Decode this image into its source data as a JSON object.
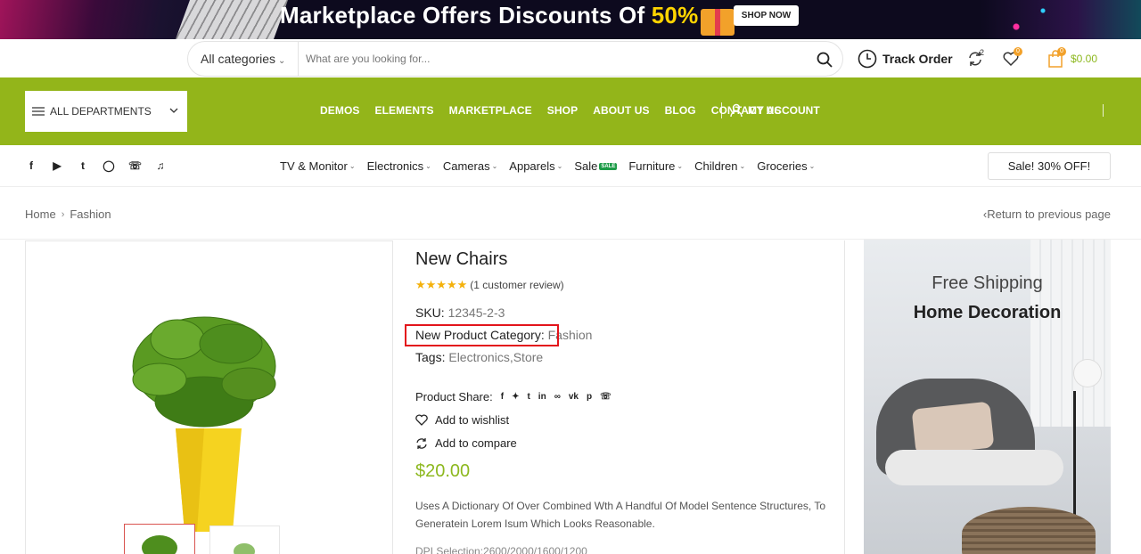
{
  "promo": {
    "headline": "Marketplace Offers Discounts Of ",
    "highlight": "50%",
    "cta": "SHOP NOW"
  },
  "search": {
    "category": "All categories",
    "placeholder": "What are you looking for...",
    "track_label": "Track Order",
    "compare_count": "2",
    "wishlist_count": "0",
    "cart_count": "0",
    "cart_total": "$0.00"
  },
  "nav": {
    "all_departments": "ALL DEPARTMENTS",
    "items": [
      "DEMOS",
      "ELEMENTS",
      "MARKETPLACE",
      "SHOP",
      "ABOUT US",
      "BLOG",
      "CONTACT US"
    ],
    "my_account": "MY ACCOUNT"
  },
  "categories": {
    "items": [
      "TV & Monitor",
      "Electronics",
      "Cameras",
      "Apparels",
      "Sale",
      "Furniture",
      "Children",
      "Groceries"
    ],
    "sale_badge": "SALE",
    "sale_button": "Sale! 30% OFF!"
  },
  "breadcrumb": {
    "home": "Home",
    "current": "Fashion",
    "return": "Return to previous page"
  },
  "product": {
    "title": "New Chairs",
    "rating": 5,
    "review_text": "(1 customer review)",
    "sku_label": "SKU:",
    "sku_value": "12345-2-3",
    "category_label": "New Product Category:",
    "category_value": "Fashion",
    "tags_label": "Tags:",
    "tag_1": "Electronics",
    "tag_sep": ",",
    "tag_2": "Store",
    "share_label": "Product Share:",
    "wishlist_label": "Add to wishlist",
    "compare_label": "Add to compare",
    "price": "$20.00",
    "description": "Uses A Dictionary Of Over Combined Wth A Handful Of Model Sentence Structures, To Generatein Lorem Isum Which Looks Reasonable.",
    "dpi_line": "DPI Selection:2600/2000/1600/1200"
  },
  "banner": {
    "line1": "Free Shipping",
    "line2": "Home Decoration"
  },
  "colors": {
    "brand_green": "#93b51a",
    "price_green": "#8db81f",
    "highlight_red": "#e3141b",
    "star": "#f4b10b"
  }
}
